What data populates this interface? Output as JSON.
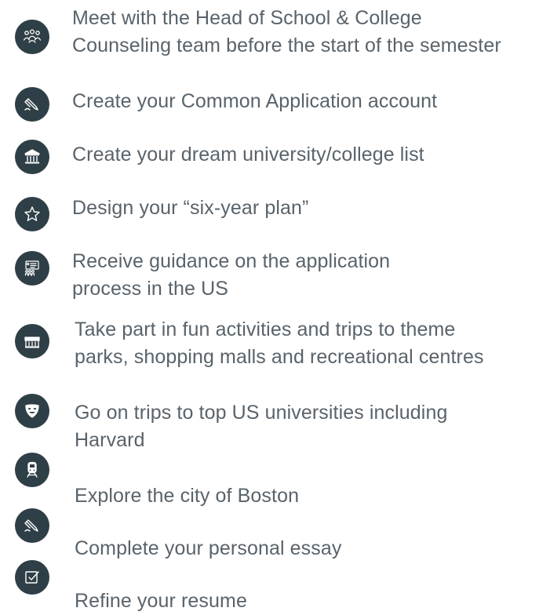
{
  "colors": {
    "icon_background": "#2f3f47",
    "icon_stroke": "#ffffff",
    "text": "#59636b"
  },
  "items": [
    {
      "icon": "people-group-icon",
      "lines": [
        "Meet with the Head of School & College",
        "Counseling team before the start of the semester"
      ]
    },
    {
      "icon": "pen-writing-icon",
      "lines": [
        "Create your Common Application account"
      ]
    },
    {
      "icon": "university-building-icon",
      "lines": [
        "Create your dream university/college list"
      ]
    },
    {
      "icon": "star-icon",
      "lines": [
        "Design your “six-year plan”"
      ]
    },
    {
      "icon": "presentation-board-icon",
      "lines": [
        "Receive guidance on the application",
        "process in the US"
      ]
    },
    {
      "icon": "storefront-icon",
      "lines": [
        "Take part in fun activities and trips to theme",
        "parks, shopping malls and recreational centres"
      ]
    },
    {
      "icon": "theatre-masks-icon",
      "lines": [
        "Go on trips to top US universities including",
        "Harvard"
      ]
    },
    {
      "icon": "train-icon",
      "lines": [
        "Explore the city of Boston"
      ]
    },
    {
      "icon": "pen-writing-icon",
      "lines": [
        "Complete your personal essay"
      ]
    },
    {
      "icon": "checkbox-edit-icon",
      "lines": [
        "Refine your resume"
      ]
    }
  ]
}
